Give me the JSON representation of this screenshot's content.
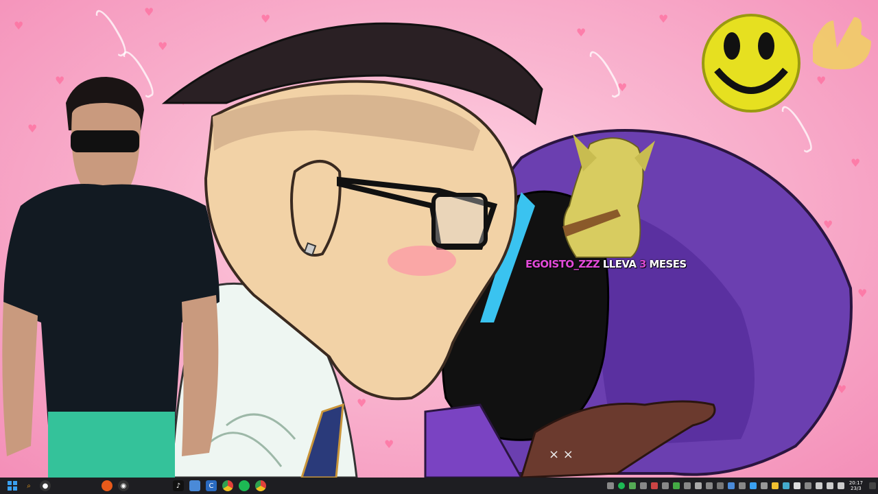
{
  "alert": {
    "username": "EGOISTO_ZZZ",
    "text_mid": "LLEVA",
    "months": "3",
    "text_end": "MESES"
  },
  "taskbar": {
    "clock_time": "20:17",
    "clock_date": "23/3",
    "pinned_icons": [
      "windows-start-icon",
      "search-icon",
      "copilot-icon",
      "firefox-icon",
      "obs-icon",
      "tiktok-icon",
      "photos-icon",
      "cursor-app-icon",
      "chrome-icon",
      "spotify-icon",
      "chrome-icon"
    ],
    "tray_icons": [
      "mic-icon",
      "spotify-icon",
      "app-icon",
      "app-icon",
      "app-icon",
      "app-icon",
      "app-icon",
      "app-icon",
      "app-icon",
      "app-icon",
      "app-icon",
      "app-icon",
      "app-icon",
      "app-icon",
      "app-icon",
      "folder-icon",
      "app-icon",
      "app-icon",
      "app-icon",
      "network-icon",
      "volume-icon",
      "battery-icon"
    ]
  },
  "colors": {
    "background": "#f6a9c8",
    "hair_purple": "#6b3fb0",
    "taskbar": "#1e1e22"
  }
}
